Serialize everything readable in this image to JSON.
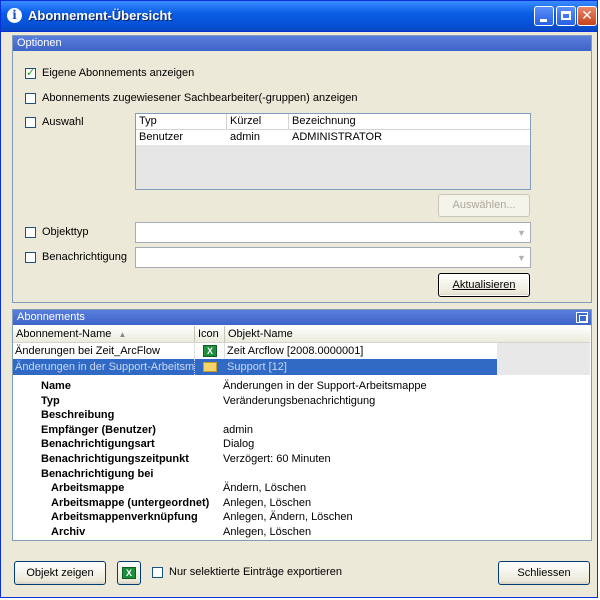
{
  "window": {
    "title": "Abonnement-Übersicht",
    "icon": "info-icon"
  },
  "options": {
    "header": "Optionen",
    "own_subscriptions": {
      "label": "Eigene Abonnements anzeigen",
      "checked": true
    },
    "assigned_subscriptions": {
      "label": "Abonnements zugewiesener Sachbearbeiter(-gruppen) anzeigen",
      "checked": false
    },
    "selection": {
      "label": "Auswahl",
      "checked": false
    },
    "selection_list": {
      "columns": [
        "Typ",
        "Kürzel",
        "Bezeichnung"
      ],
      "rows": [
        [
          "Benutzer",
          "admin",
          "ADMINISTRATOR"
        ]
      ]
    },
    "select_button": "Auswählen...",
    "object_type": {
      "label": "Objekttyp",
      "checked": false
    },
    "notification": {
      "label": "Benachrichtigung",
      "checked": false
    },
    "refresh_button": "Aktualisieren"
  },
  "subscriptions": {
    "header": "Abonnements",
    "columns": [
      "Abonnement-Name",
      "Icon",
      "Objekt-Name"
    ],
    "rows": [
      {
        "name": "Änderungen bei Zeit_ArcFlow",
        "icon": "excel-icon",
        "object": "Zeit Arcflow [2008.0000001]",
        "selected": false
      },
      {
        "name": "Änderungen in der Support-Arbeitsmappe",
        "icon": "folder-icon",
        "object": "Support [12]",
        "selected": true
      }
    ],
    "details": [
      {
        "key": "Name",
        "value": "Änderungen in der Support-Arbeitsmappe",
        "indent": false
      },
      {
        "key": "Typ",
        "value": "Veränderungsbenachrichtigung",
        "indent": false
      },
      {
        "key": "Beschreibung",
        "value": "",
        "indent": false
      },
      {
        "key": "Empfänger (Benutzer)",
        "value": "admin",
        "indent": false
      },
      {
        "key": "Benachrichtigungsart",
        "value": "Dialog",
        "indent": false
      },
      {
        "key": "Benachrichtigungszeitpunkt",
        "value": "Verzögert: 60 Minuten",
        "indent": false
      },
      {
        "key": "Benachrichtigung bei",
        "value": "",
        "indent": false
      },
      {
        "key": "Arbeitsmappe",
        "value": "Ändern, Löschen",
        "indent": true
      },
      {
        "key": "Arbeitsmappe (untergeordnet)",
        "value": "Anlegen, Löschen",
        "indent": true
      },
      {
        "key": "Arbeitsmappenverknüpfung",
        "value": "Anlegen, Ändern, Löschen",
        "indent": true
      },
      {
        "key": "Archiv",
        "value": "Anlegen, Löschen",
        "indent": true
      }
    ]
  },
  "footer": {
    "show_object_button": "Objekt zeigen",
    "export_label": "Nur selektierte Einträge exportieren",
    "export_checked": false,
    "close_button": "Schliessen"
  },
  "colors": {
    "title_bar": "#0a5fe6",
    "selection": "#316ac5",
    "group_header": "#4a70d4"
  }
}
